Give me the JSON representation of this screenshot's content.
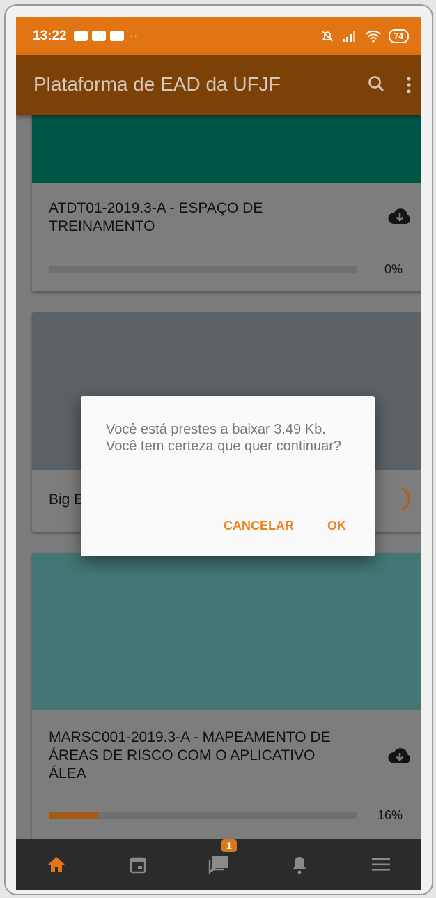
{
  "status_bar": {
    "time": "13:22",
    "battery": "74"
  },
  "app_bar": {
    "title": "Plataforma de EAD da UFJF"
  },
  "courses": [
    {
      "title": "ATDT01-2019.3-A - ESPAÇO DE TREINAMENTO",
      "progress_percent": 0,
      "progress_label": "0%",
      "banner_color": "#005646"
    },
    {
      "title": "Big E",
      "banner_color": "#5b6165"
    },
    {
      "title": "MARSC001-2019.3-A - MAPEAMENTO DE ÁREAS DE RISCO COM O APLICATIVO ÁLEA",
      "progress_percent": 16,
      "progress_label": "16%",
      "banner_color": "#437674"
    }
  ],
  "dialog": {
    "message": "Você está prestes a baixar 3.49 Kb. Você tem certeza que quer continuar?",
    "cancel_label": "CANCELAR",
    "ok_label": "OK"
  },
  "bottom_nav": {
    "messages_badge": "1"
  },
  "colors": {
    "accent": "#e17413",
    "appbar": "#7b4107",
    "dialog_button": "#ea8320"
  }
}
